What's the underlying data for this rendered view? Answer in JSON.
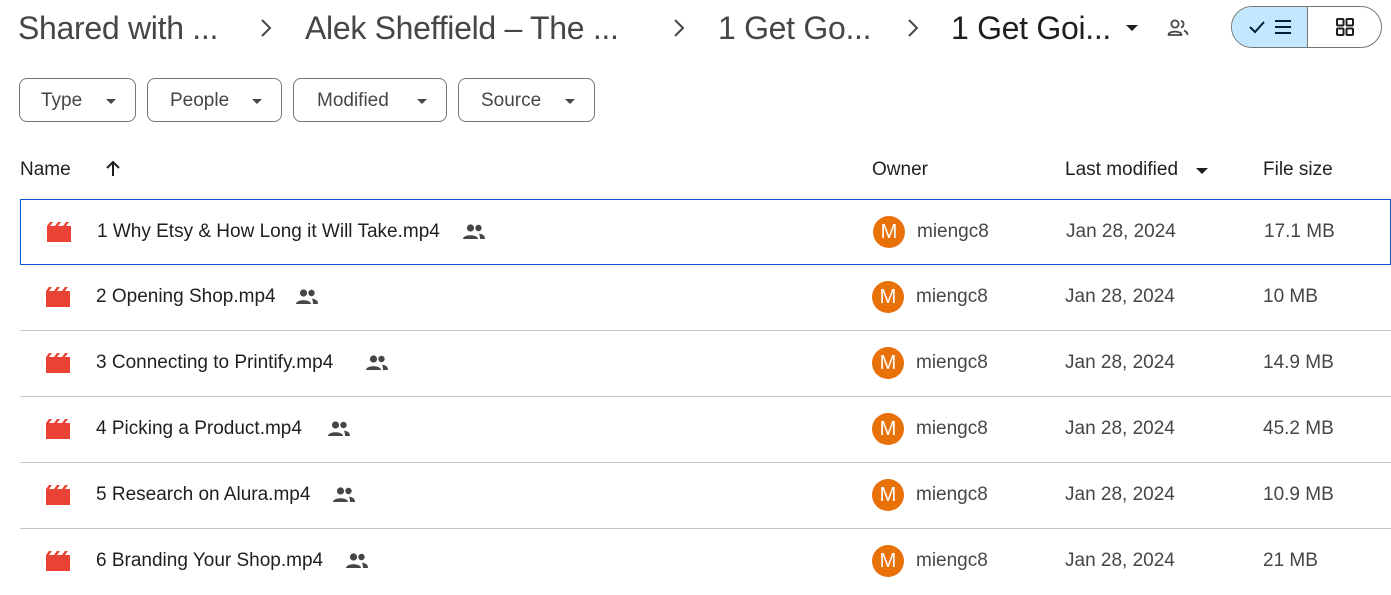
{
  "breadcrumb": {
    "items": [
      "Shared with ...",
      "Alek Sheffield – The ...",
      "1 Get Go...",
      "1 Get Goi..."
    ]
  },
  "view_toggle": {
    "selected": "list"
  },
  "filters": {
    "chips": [
      {
        "label": "Type"
      },
      {
        "label": "People"
      },
      {
        "label": "Modified"
      },
      {
        "label": "Source"
      }
    ]
  },
  "columns": {
    "name": "Name",
    "owner": "Owner",
    "last_modified": "Last modified",
    "file_size": "File size"
  },
  "files": [
    {
      "name": "1 Why Etsy & How Long it Will Take.mp4",
      "owner_initial": "M",
      "owner": "miengc8",
      "modified": "Jan 28, 2024",
      "size": "17.1 MB"
    },
    {
      "name": "2 Opening Shop.mp4",
      "owner_initial": "M",
      "owner": "miengc8",
      "modified": "Jan 28, 2024",
      "size": "10 MB"
    },
    {
      "name": "3 Connecting to Printify.mp4",
      "owner_initial": "M",
      "owner": "miengc8",
      "modified": "Jan 28, 2024",
      "size": "14.9 MB"
    },
    {
      "name": "4 Picking a Product.mp4",
      "owner_initial": "M",
      "owner": "miengc8",
      "modified": "Jan 28, 2024",
      "size": "45.2 MB"
    },
    {
      "name": "5 Research on Alura.mp4",
      "owner_initial": "M",
      "owner": "miengc8",
      "modified": "Jan 28, 2024",
      "size": "10.9 MB"
    },
    {
      "name": "6 Branding Your Shop.mp4",
      "owner_initial": "M",
      "owner": "miengc8",
      "modified": "Jan 28, 2024",
      "size": "21 MB"
    }
  ],
  "colors": {
    "accent": "#0b57d0",
    "toggle_selected": "#c2e7ff",
    "video_icon": "#ea4335",
    "avatar": "#e8710a"
  }
}
